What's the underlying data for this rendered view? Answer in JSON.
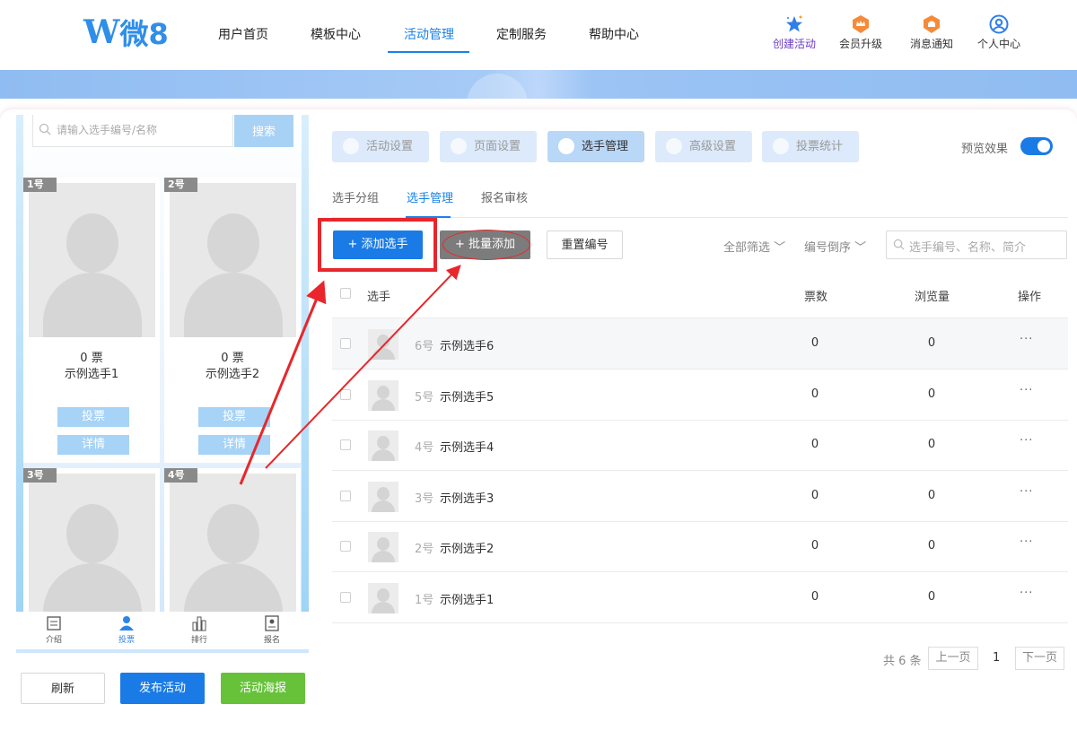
{
  "header": {
    "logo_text": "微8",
    "nav": [
      "用户首页",
      "模板中心",
      "活动管理",
      "定制服务",
      "帮助中心"
    ],
    "actions": [
      "创建活动",
      "会员升级",
      "消息通知",
      "个人中心"
    ]
  },
  "phone": {
    "search_placeholder": "请输入选手编号/名称",
    "search_button": "搜索",
    "cards": [
      {
        "num": "1号",
        "votes": "0 票",
        "name": "示例选手1",
        "vote_btn": "投票",
        "detail_btn": "详情"
      },
      {
        "num": "2号",
        "votes": "0 票",
        "name": "示例选手2",
        "vote_btn": "投票",
        "detail_btn": "详情"
      },
      {
        "num": "3号"
      },
      {
        "num": "4号"
      }
    ],
    "tabbar": [
      "介绍",
      "投票",
      "排行",
      "报名"
    ]
  },
  "left_buttons": {
    "refresh": "刷新",
    "publish": "发布活动",
    "poster": "活动海报"
  },
  "settings_tabs": [
    "活动设置",
    "页面设置",
    "选手管理",
    "高级设置",
    "投票统计"
  ],
  "preview_label": "预览效果",
  "sub_tabs": [
    "选手分组",
    "选手管理",
    "报名审核"
  ],
  "toolbar": {
    "add": "+ 添加选手",
    "batch": "+ 批量添加",
    "renumber": "重置编号",
    "filter_all": "全部筛选",
    "sort": "编号倒序",
    "search_placeholder": "选手编号、名称、简介"
  },
  "table": {
    "headers": {
      "player": "选手",
      "votes": "票数",
      "views": "浏览量",
      "ops": "操作"
    },
    "rows": [
      {
        "num": "6号",
        "name": "示例选手6",
        "votes": "0",
        "views": "0",
        "ops": "···"
      },
      {
        "num": "5号",
        "name": "示例选手5",
        "votes": "0",
        "views": "0",
        "ops": "···"
      },
      {
        "num": "4号",
        "name": "示例选手4",
        "votes": "0",
        "views": "0",
        "ops": "···"
      },
      {
        "num": "3号",
        "name": "示例选手3",
        "votes": "0",
        "views": "0",
        "ops": "···"
      },
      {
        "num": "2号",
        "name": "示例选手2",
        "votes": "0",
        "views": "0",
        "ops": "···"
      },
      {
        "num": "1号",
        "name": "示例选手1",
        "votes": "0",
        "views": "0",
        "ops": "···"
      }
    ]
  },
  "pagination": {
    "total": "共 6 条",
    "prev": "上一页",
    "current": "1",
    "next": "下一页"
  },
  "colors": {
    "primary": "#1a7be6",
    "green": "#67c23a",
    "annotation_red": "#e8262b"
  }
}
